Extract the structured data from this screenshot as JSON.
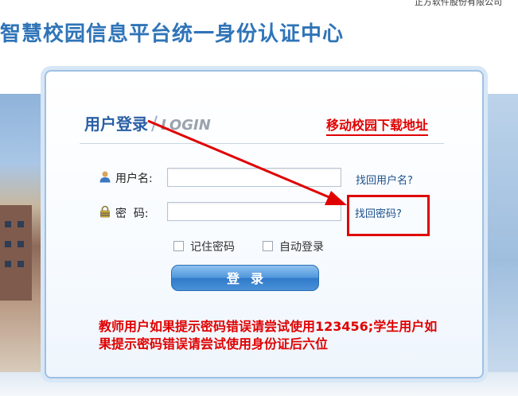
{
  "header": {
    "company": "正方软件股份有限公司",
    "title": "智慧校园信息平台统一身份认证中心"
  },
  "login": {
    "title": "用户登录",
    "separator": "/",
    "subtitle": "LOGIN",
    "mobile_link": "移动校园下载地址",
    "username_label": "用户名:",
    "username_value": "",
    "password_label": "密  码:",
    "password_value": "",
    "find_username": "找回用户名?",
    "find_password": "找回密码?",
    "remember_password": "记住密码",
    "auto_login": "自动登录",
    "login_button": "登录",
    "notice": "教师用户如果提示密码错误请尝试使用123456;学生用户如果提示密码错误请尝试使用身份证后六位"
  },
  "colors": {
    "brand": "#2f74b8",
    "annotation": "#e00000",
    "button": "#4f96dc"
  },
  "icons": {
    "user": "user-icon",
    "lock": "lock-icon"
  }
}
